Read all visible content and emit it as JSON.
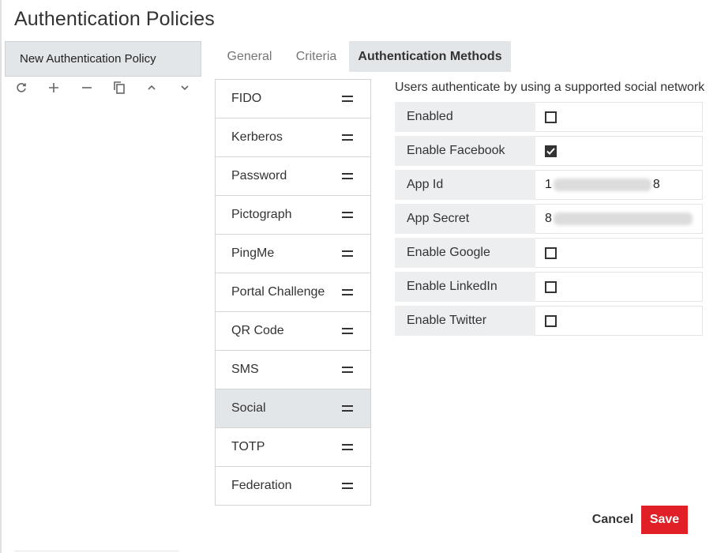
{
  "page": {
    "title": "Authentication Policies"
  },
  "policy_list": {
    "items": [
      {
        "label": "New Authentication Policy"
      }
    ],
    "toolbar": [
      {
        "icon": "refresh-icon"
      },
      {
        "icon": "plus-icon"
      },
      {
        "icon": "minus-icon"
      },
      {
        "icon": "copy-icon"
      },
      {
        "icon": "chevron-up-icon"
      },
      {
        "icon": "chevron-down-icon"
      }
    ]
  },
  "tabs": [
    {
      "label": "General",
      "active": false
    },
    {
      "label": "Criteria",
      "active": false
    },
    {
      "label": "Authentication Methods",
      "active": true
    }
  ],
  "methods": [
    {
      "label": "FIDO"
    },
    {
      "label": "Kerberos"
    },
    {
      "label": "Password"
    },
    {
      "label": "Pictograph"
    },
    {
      "label": "PingMe"
    },
    {
      "label": "Portal Challenge"
    },
    {
      "label": "QR Code"
    },
    {
      "label": "SMS"
    },
    {
      "label": "Social",
      "selected": true
    },
    {
      "label": "TOTP"
    },
    {
      "label": "Federation"
    }
  ],
  "detail": {
    "description": "Users authenticate by using a supported social network",
    "fields": {
      "enabled": {
        "label": "Enabled",
        "checked": false
      },
      "enable_facebook": {
        "label": "Enable Facebook",
        "checked": true
      },
      "app_id": {
        "label": "App Id",
        "value_start": "1",
        "value_end": "8"
      },
      "app_secret": {
        "label": "App Secret",
        "value_start": "8"
      },
      "enable_google": {
        "label": "Enable Google",
        "checked": false
      },
      "enable_linkedin": {
        "label": "Enable LinkedIn",
        "checked": false
      },
      "enable_twitter": {
        "label": "Enable Twitter",
        "checked": false
      }
    }
  },
  "actions": {
    "cancel_label": "Cancel",
    "save_label": "Save"
  },
  "colors": {
    "accent_red": "#e01f26",
    "selected_bg": "#e3e6e8",
    "label_bg": "#eceef0"
  }
}
